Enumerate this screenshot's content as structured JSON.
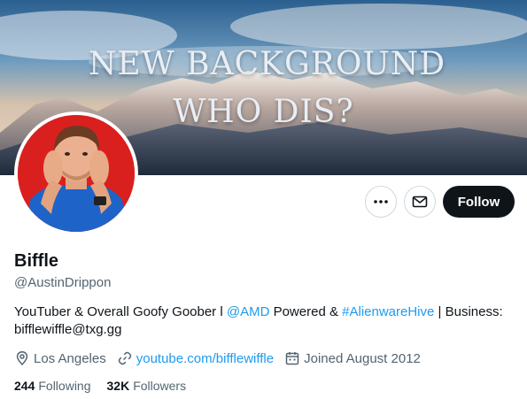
{
  "banner": {
    "line1": "NEW BACKGROUND",
    "line2": "WHO DIS?"
  },
  "profile": {
    "display_name": "Biffle",
    "handle": "@AustinDrippon",
    "bio": {
      "part1": "YouTuber & Overall Goofy Goober l ",
      "mention": "@AMD",
      "part2": " Powered & ",
      "hashtag": "#AlienwareHive",
      "part3": " | Business: bifflewiffle@txg.gg"
    },
    "location": "Los Angeles",
    "website": "youtube.com/bifflewiffle",
    "joined": "Joined August 2012",
    "following_count": "244",
    "following_label": "Following",
    "followers_count": "32K",
    "followers_label": "Followers"
  },
  "actions": {
    "more_icon": "more-icon",
    "message_icon": "envelope-icon",
    "follow_label": "Follow"
  },
  "colors": {
    "accent": "#1d9bf0",
    "text": "#0f1419",
    "secondary": "#536471",
    "follow_bg": "#0f1419",
    "avatar_bg": "#d9201f"
  }
}
